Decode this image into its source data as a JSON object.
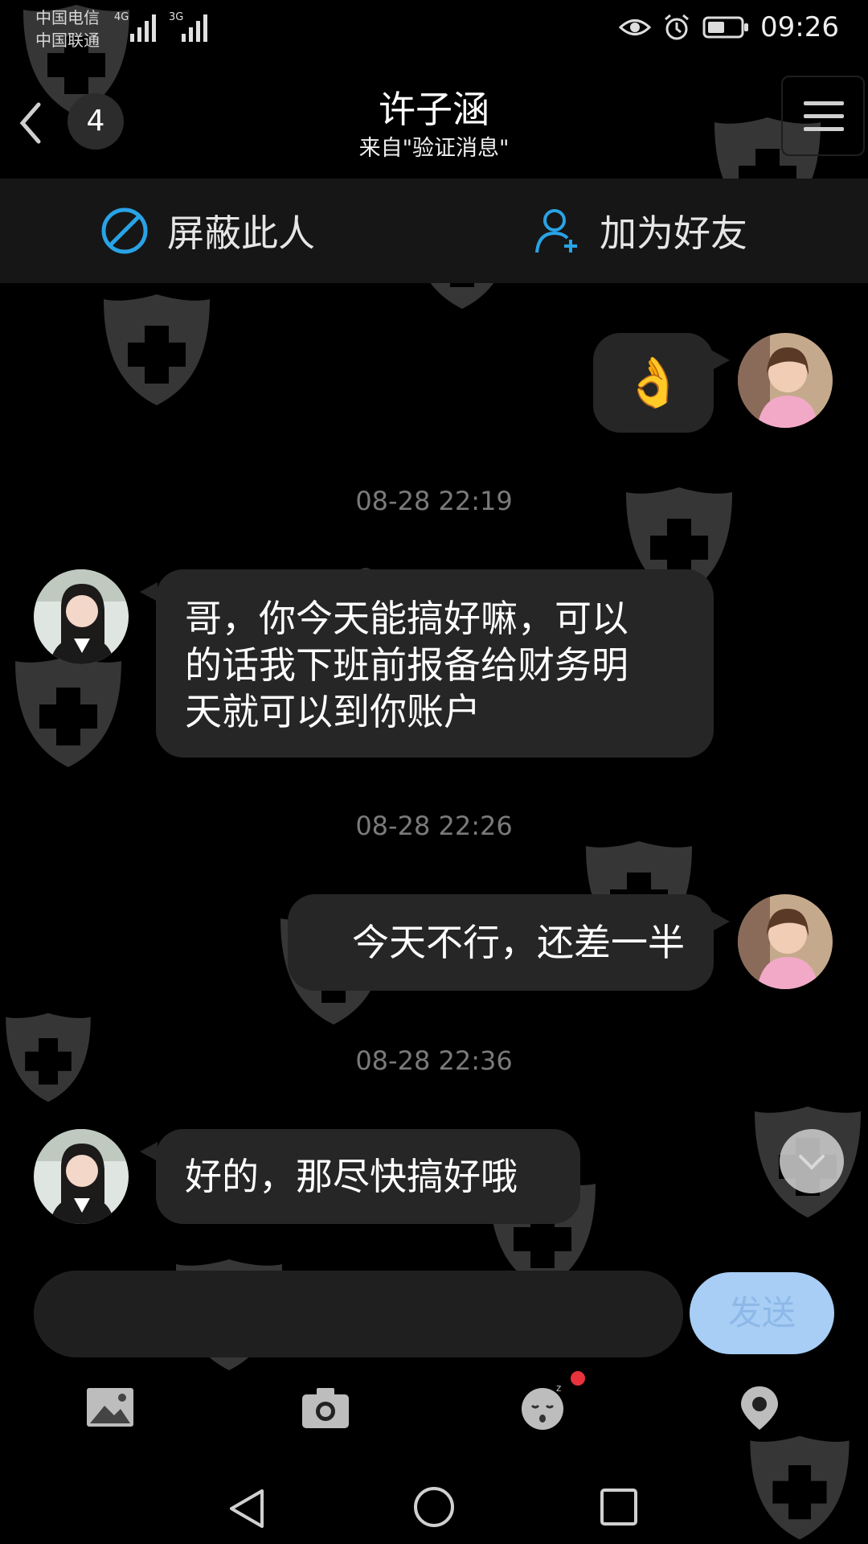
{
  "status_bar": {
    "carrier_1": "中国电信",
    "carrier_2": "中国联通",
    "network_1": "4G",
    "network_2": "3G",
    "time": "09:26",
    "icons": [
      "eye-icon",
      "alarm-icon",
      "battery-icon"
    ]
  },
  "header": {
    "back_icon": "chevron-left-icon",
    "unread_count": "4",
    "title": "许子涵",
    "subtitle": "来自\"验证消息\"",
    "menu_icon": "menu-icon"
  },
  "actions": {
    "block_label": "屏蔽此人",
    "add_friend_label": "加为好友",
    "accent_color": "#29a3e6"
  },
  "messages": [
    {
      "side": "right",
      "type": "emoji",
      "emoji": "👌"
    },
    {
      "timestamp": "08-28 22:19"
    },
    {
      "side": "left",
      "type": "text",
      "lines": [
        "哥，你今天能搞好嘛，可以",
        "的话我下班前报备给财务明",
        "天就可以到你账户"
      ]
    },
    {
      "timestamp": "08-28 22:26"
    },
    {
      "side": "right",
      "type": "text",
      "text": "今天不行，还差一半"
    },
    {
      "timestamp": "08-28 22:36"
    },
    {
      "side": "left",
      "type": "text",
      "text": "好的，那尽快搞好哦"
    }
  ],
  "composer": {
    "input_value": "",
    "send_label": "发送",
    "send_color": "#a8cef5"
  },
  "toolbar": {
    "icons": [
      "image-icon",
      "camera-icon",
      "emoji-face-icon",
      "location-icon"
    ]
  },
  "nav": {
    "icons": [
      "back-triangle-icon",
      "home-circle-icon",
      "recents-square-icon"
    ]
  }
}
